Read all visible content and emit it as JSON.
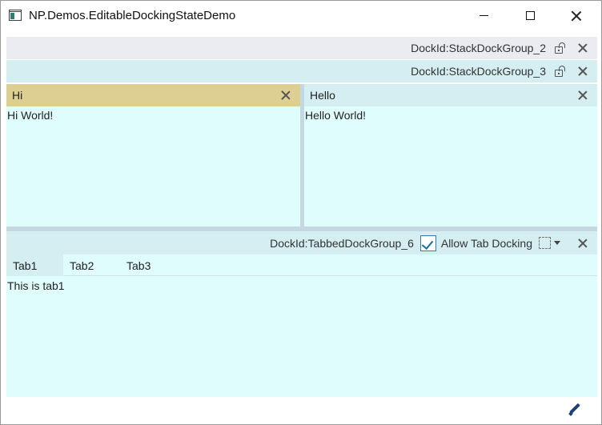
{
  "window": {
    "title": "NP.Demos.EditableDockingStateDemo"
  },
  "stack_group_2": {
    "label": "DockId:StackDockGroup_2"
  },
  "stack_group_3": {
    "label": "DockId:StackDockGroup_3"
  },
  "panes": {
    "hi": {
      "title": "Hi",
      "content": "Hi World!",
      "header_color": "#dccf91"
    },
    "hello": {
      "title": "Hello",
      "content": "Hello World!",
      "header_color": "#d4eef1"
    }
  },
  "tabbed_group": {
    "label": "DockId:TabbedDockGroup_6",
    "allow_tab_docking_label": "Allow Tab Docking",
    "allow_tab_docking_checked": true,
    "tabs": [
      {
        "label": "Tab1",
        "active": true
      },
      {
        "label": "Tab2",
        "active": false
      },
      {
        "label": "Tab3",
        "active": false
      }
    ],
    "active_content": "This is tab1"
  },
  "icons": {
    "app": "app-window-icon",
    "lock": "unlock-icon",
    "close": "close-icon",
    "check": "check-icon",
    "dock_mode": "dashed-box-icon",
    "edit": "pencil-icon"
  },
  "colors": {
    "pane_background": "#e0fdfd",
    "group_header": "#d4eef1",
    "active_pane_header": "#dccf91",
    "accent": "#1a6f9a"
  }
}
